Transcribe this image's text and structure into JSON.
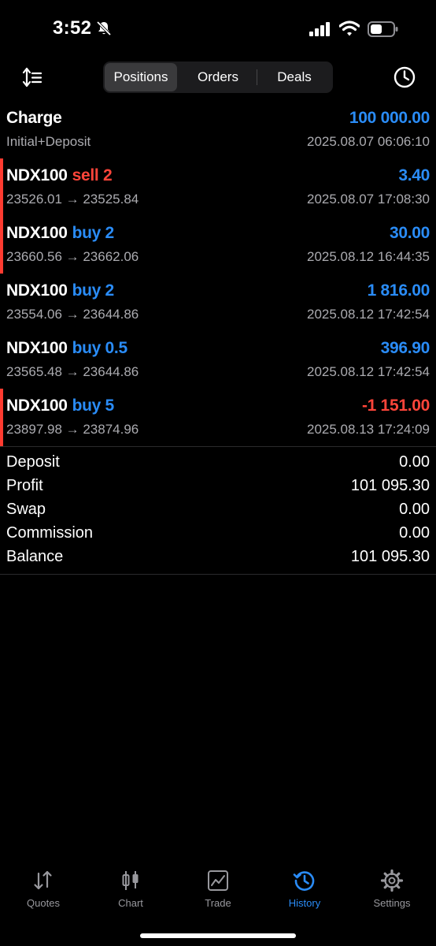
{
  "status": {
    "time": "3:52"
  },
  "segments": [
    "Positions",
    "Orders",
    "Deals"
  ],
  "charge": {
    "title": "Charge",
    "subtitle": "Initial+Deposit",
    "value": "100 000.00",
    "date": "2025.08.07 06:06:10"
  },
  "positions": [
    {
      "symbol": "NDX100",
      "side": "sell 2",
      "side_color": "red",
      "prices": "23526.01 → 23525.84",
      "profit": "3.40",
      "profit_color": "blue",
      "date": "2025.08.07 17:08:30",
      "accent": true
    },
    {
      "symbol": "NDX100",
      "side": "buy 2",
      "side_color": "blue",
      "prices": "23660.56 → 23662.06",
      "profit": "30.00",
      "profit_color": "blue",
      "date": "2025.08.12 16:44:35",
      "accent": true
    },
    {
      "symbol": "NDX100",
      "side": "buy 2",
      "side_color": "blue",
      "prices": "23554.06 → 23644.86",
      "profit": "1 816.00",
      "profit_color": "blue",
      "date": "2025.08.12 17:42:54",
      "accent": false
    },
    {
      "symbol": "NDX100",
      "side": "buy 0.5",
      "side_color": "blue",
      "prices": "23565.48 → 23644.86",
      "profit": "396.90",
      "profit_color": "blue",
      "date": "2025.08.12 17:42:54",
      "accent": false
    },
    {
      "symbol": "NDX100",
      "side": "buy 5",
      "side_color": "blue",
      "prices": "23897.98 → 23874.96",
      "profit": "-1 151.00",
      "profit_color": "red",
      "date": "2025.08.13 17:24:09",
      "accent": true
    }
  ],
  "summary": [
    {
      "label": "Deposit",
      "value": "0.00"
    },
    {
      "label": "Profit",
      "value": "101 095.30"
    },
    {
      "label": "Swap",
      "value": "0.00"
    },
    {
      "label": "Commission",
      "value": "0.00"
    },
    {
      "label": "Balance",
      "value": "101 095.30"
    }
  ],
  "tabs": [
    {
      "label": "Quotes",
      "icon": "quotes-icon"
    },
    {
      "label": "Chart",
      "icon": "chart-icon"
    },
    {
      "label": "Trade",
      "icon": "trade-icon"
    },
    {
      "label": "History",
      "icon": "history-icon",
      "active": true
    },
    {
      "label": "Settings",
      "icon": "settings-icon"
    }
  ],
  "colors": {
    "blue": "#2a8cf7",
    "red": "#ff453a",
    "accent_bar": "#ff3b30"
  }
}
